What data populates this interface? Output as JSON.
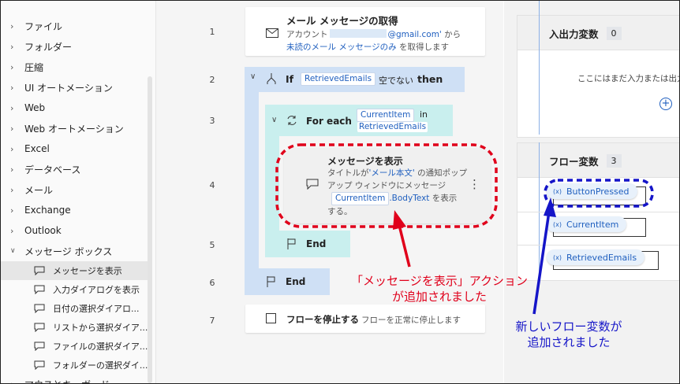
{
  "sidebar": {
    "groups": [
      {
        "label": "ファイル"
      },
      {
        "label": "フォルダー"
      },
      {
        "label": "圧縮"
      },
      {
        "label": "UI オートメーション"
      },
      {
        "label": "Web"
      },
      {
        "label": "Web オートメーション"
      },
      {
        "label": "Excel"
      },
      {
        "label": "データベース"
      },
      {
        "label": "メール"
      },
      {
        "label": "Exchange"
      },
      {
        "label": "Outlook"
      },
      {
        "label": "メッセージ ボックス"
      }
    ],
    "subitems": [
      {
        "label": "メッセージを表示"
      },
      {
        "label": "入力ダイアログを表示"
      },
      {
        "label": "日付の選択ダイアロ..."
      },
      {
        "label": "リストから選択ダイア..."
      },
      {
        "label": "ファイルの選択ダイア..."
      },
      {
        "label": "フォルダーの選択ダイ..."
      }
    ],
    "cut_item": "マウスとキーボード"
  },
  "flow": {
    "line_numbers": [
      "1",
      "2",
      "3",
      "4",
      "5",
      "6",
      "7"
    ],
    "step1": {
      "title": "メール メッセージの取得",
      "desc_prefix": "アカウント",
      "desc_email": "@gmail.com'",
      "desc_suffix": "から",
      "desc_link": "未読のメール メッセージのみ",
      "desc_end": "を取得します"
    },
    "step2": {
      "keyword": "If",
      "var": "RetrievedEmails",
      "condition": "空でない",
      "then": "then"
    },
    "step3": {
      "keyword": "For each",
      "var1": "CurrentItem",
      "in": "in",
      "var2": "RetrievedEmails"
    },
    "step4": {
      "title": "メッセージを表示",
      "desc1": "タイトルが",
      "desc_quote": "'メール本文'",
      "desc2": "の通知ポップ",
      "desc3": "アップ ウィンドウにメッセージ",
      "var": "CurrentItem",
      "var_prop": ".BodyText",
      "desc4": "を表示",
      "desc5": "する。",
      "more": "⋮"
    },
    "step5": {
      "label": "End"
    },
    "step6": {
      "label": "End"
    },
    "step7": {
      "title": "フローを停止する",
      "desc": "フローを正常に停止します"
    }
  },
  "variables": {
    "io": {
      "title": "入出力変数",
      "count": "0",
      "empty_text": "ここにはまだ入力または出力"
    },
    "flow": {
      "title": "フロー変数",
      "count": "3",
      "items": [
        "ButtonPressed",
        "CurrentItem",
        "RetrievedEmails"
      ],
      "var_prefix": "(x)"
    }
  },
  "annotations": {
    "red": [
      "「メッセージを表示」アクション",
      "が追加されました"
    ],
    "blue": [
      "新しいフロー変数が",
      "追加されました"
    ]
  },
  "colors": {
    "annotation_red": "#e0001b",
    "annotation_blue": "#1515c8",
    "accent_blue": "#1f5fbf"
  }
}
